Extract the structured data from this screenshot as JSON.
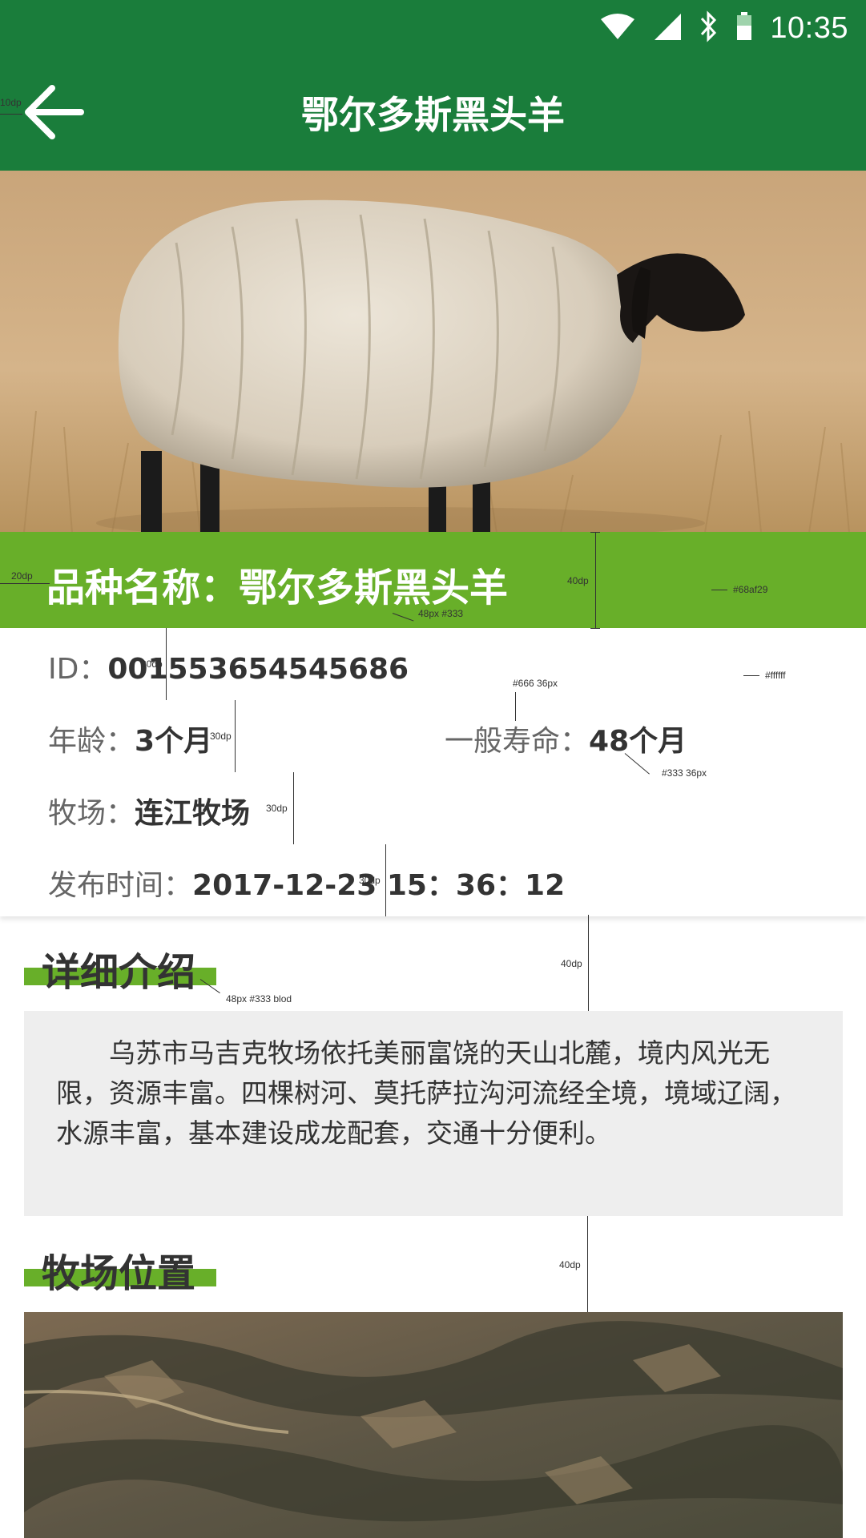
{
  "status_bar": {
    "time": "10:35"
  },
  "app_bar": {
    "title": "鄂尔多斯黑头羊"
  },
  "breed": {
    "label": "品种名称：",
    "value": "鄂尔多斯黑头羊"
  },
  "info": {
    "id_label": "ID：",
    "id_value": "001553654545686",
    "age_label": "年龄：",
    "age_value": "3个月",
    "lifespan_label": "一般寿命：",
    "lifespan_value": "48个月",
    "ranch_label": "牧场：",
    "ranch_value": "连江牧场",
    "published_label": "发布时间：",
    "published_value": "2017-12-23  15：36：12"
  },
  "intro": {
    "title": "详细介绍",
    "text": "乌苏市马吉克牧场依托美丽富饶的天山北麓，境内风光无限，资源丰富。四棵树河、莫托萨拉沟河流经全境，境域辽阔，水源丰富，基本建设成龙配套，交通十分便利。"
  },
  "location": {
    "title": "牧场位置"
  },
  "annotations": {
    "a_back": "10dp",
    "a_band_margin": "20dp",
    "a_band_height": "40dp",
    "a_band_font": "48px #333",
    "a_band_color": "#68af29",
    "a_card_color": "#ffffff",
    "a_key_font": "#666 36px",
    "a_val_font": "#333 36px",
    "a_row1": "30dp",
    "a_row2": "30dp",
    "a_row3": "30dp",
    "a_row4": "30dp",
    "a_sec1": "40dp",
    "a_sec_font": "48px #333 blod",
    "a_sec2": "40dp"
  },
  "colors": {
    "primary": "#1a7d3b",
    "accent": "#68af29",
    "panel": "#eeeeee",
    "key_text": "#666666",
    "value_text": "#333333"
  }
}
